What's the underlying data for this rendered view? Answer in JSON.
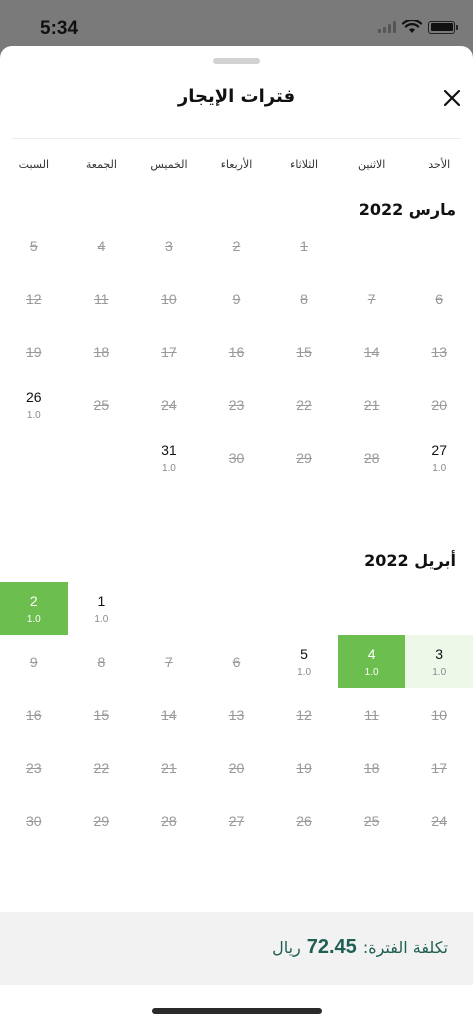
{
  "status": {
    "time": "5:34"
  },
  "sheet": {
    "title": "فترات الإيجار"
  },
  "weekdays": [
    "الأحد",
    "الاثنين",
    "الثلاثاء",
    "الأربعاء",
    "الخميس",
    "الجمعة",
    "السبت"
  ],
  "months": [
    {
      "title": "مارس 2022",
      "weeks": [
        [
          null,
          null,
          {
            "day": "1",
            "disabled": true
          },
          {
            "day": "2",
            "disabled": true
          },
          {
            "day": "3",
            "disabled": true
          },
          {
            "day": "4",
            "disabled": true
          },
          {
            "day": "5",
            "disabled": true
          }
        ],
        [
          {
            "day": "6",
            "disabled": true
          },
          {
            "day": "7",
            "disabled": true
          },
          {
            "day": "8",
            "disabled": true
          },
          {
            "day": "9",
            "disabled": true
          },
          {
            "day": "10",
            "disabled": true
          },
          {
            "day": "11",
            "disabled": true
          },
          {
            "day": "12",
            "disabled": true
          }
        ],
        [
          {
            "day": "13",
            "disabled": true
          },
          {
            "day": "14",
            "disabled": true
          },
          {
            "day": "15",
            "disabled": true
          },
          {
            "day": "16",
            "disabled": true
          },
          {
            "day": "17",
            "disabled": true
          },
          {
            "day": "18",
            "disabled": true
          },
          {
            "day": "19",
            "disabled": true
          }
        ],
        [
          {
            "day": "20",
            "disabled": true
          },
          {
            "day": "21",
            "disabled": true
          },
          {
            "day": "22",
            "disabled": true
          },
          {
            "day": "23",
            "disabled": true
          },
          {
            "day": "24",
            "disabled": true
          },
          {
            "day": "25",
            "disabled": true
          },
          {
            "day": "26",
            "price": "1.0"
          }
        ],
        [
          {
            "day": "27",
            "price": "1.0"
          },
          {
            "day": "28",
            "disabled": true
          },
          {
            "day": "29",
            "disabled": true
          },
          {
            "day": "30",
            "disabled": true
          },
          {
            "day": "31",
            "price": "1.0"
          },
          null,
          null
        ]
      ]
    },
    {
      "title": "أبريل 2022",
      "weeks": [
        [
          null,
          null,
          null,
          null,
          null,
          {
            "day": "1",
            "price": "1.0"
          },
          {
            "day": "2",
            "price": "1.0",
            "state": "selected"
          }
        ],
        [
          {
            "day": "3",
            "price": "1.0",
            "state": "light"
          },
          {
            "day": "4",
            "price": "1.0",
            "state": "selected"
          },
          {
            "day": "5",
            "price": "1.0"
          },
          {
            "day": "6",
            "disabled": true
          },
          {
            "day": "7",
            "disabled": true
          },
          {
            "day": "8",
            "disabled": true
          },
          {
            "day": "9",
            "disabled": true
          }
        ],
        [
          {
            "day": "10",
            "disabled": true
          },
          {
            "day": "11",
            "disabled": true
          },
          {
            "day": "12",
            "disabled": true
          },
          {
            "day": "13",
            "disabled": true
          },
          {
            "day": "14",
            "disabled": true
          },
          {
            "day": "15",
            "disabled": true
          },
          {
            "day": "16",
            "disabled": true
          }
        ],
        [
          {
            "day": "17",
            "disabled": true
          },
          {
            "day": "18",
            "disabled": true
          },
          {
            "day": "19",
            "disabled": true
          },
          {
            "day": "20",
            "disabled": true
          },
          {
            "day": "21",
            "disabled": true
          },
          {
            "day": "22",
            "disabled": true
          },
          {
            "day": "23",
            "disabled": true
          }
        ],
        [
          {
            "day": "24",
            "disabled": true
          },
          {
            "day": "25",
            "disabled": true
          },
          {
            "day": "26",
            "disabled": true
          },
          {
            "day": "27",
            "disabled": true
          },
          {
            "day": "28",
            "disabled": true
          },
          {
            "day": "29",
            "disabled": true
          },
          {
            "day": "30",
            "disabled": true
          }
        ]
      ]
    }
  ],
  "footer": {
    "cost_label": "تكلفة الفترة:",
    "cost_value": "72.45",
    "currency": "ريال"
  },
  "colors": {
    "selected": "#6cbf4e",
    "range": "#eef8e9",
    "footer_text": "#1f5f52"
  }
}
